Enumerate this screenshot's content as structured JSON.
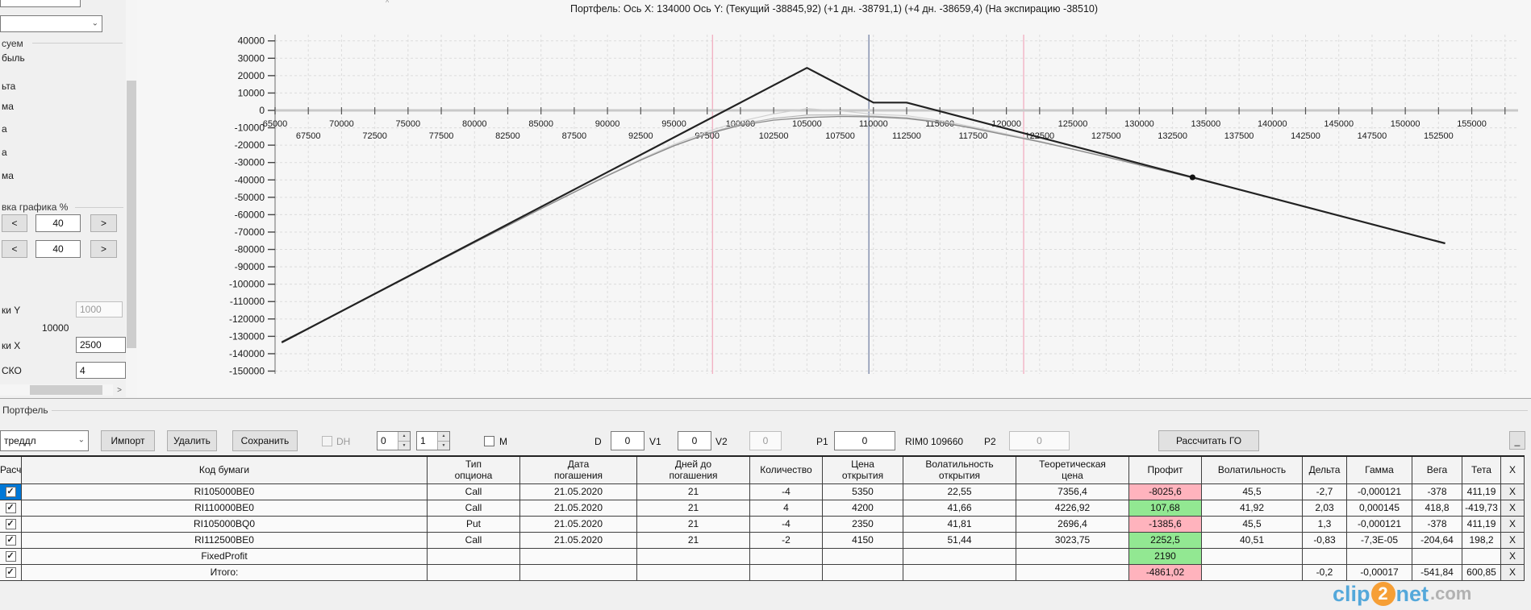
{
  "chart_data": {
    "type": "line",
    "title": "Портфель: Ось X: 134000 Ось Y:  (Текущий -38845,92)  (+1 дн. -38791,1)  (+4 дн. -38659,4)  (На экспирацию -38510)",
    "readouts": {
      "x": "134000",
      "current": "-38845,92",
      "plus1d": "-38791,1",
      "plus4d": "-38659,4",
      "expiration": "-38510"
    },
    "x_range": [
      65000,
      157500
    ],
    "y_range": [
      -150000,
      40000
    ],
    "grid": true,
    "x_minor_step": 2500,
    "y_ticks": [
      40000,
      30000,
      20000,
      10000,
      0,
      -10000,
      -20000,
      -30000,
      -40000,
      -50000,
      -60000,
      -70000,
      -80000,
      -90000,
      -100000,
      -110000,
      -120000,
      -130000,
      -140000,
      -150000
    ],
    "x_ticks_row1": [
      65000,
      70000,
      75000,
      80000,
      85000,
      90000,
      95000,
      100000,
      105000,
      110000,
      115000,
      120000,
      125000,
      130000,
      135000,
      140000,
      145000,
      150000,
      155000
    ],
    "x_ticks_row2": [
      67500,
      72500,
      77500,
      82500,
      87500,
      92500,
      97500,
      102500,
      107500,
      112500,
      117500,
      122500,
      127500,
      132500,
      137500,
      142500,
      147500,
      152500
    ],
    "vlines": [
      {
        "x": 109660,
        "color": "#7f8bab",
        "name": "current-price-line"
      },
      {
        "x": 97900,
        "color": "#f2b3c4",
        "name": "band-low-line"
      },
      {
        "x": 121300,
        "color": "#f2b3c4",
        "name": "band-high-line"
      }
    ],
    "series": [
      {
        "name": "expiration",
        "color": "#222222",
        "width": 2.2,
        "points": [
          [
            65500,
            -133510
          ],
          [
            105000,
            24490
          ],
          [
            110000,
            4490
          ],
          [
            112500,
            4490
          ],
          [
            153000,
            -76510
          ]
        ]
      },
      {
        "name": "current",
        "color": "#8a8a8a",
        "width": 1.3,
        "points": [
          [
            65500,
            -133000
          ],
          [
            70000,
            -115700
          ],
          [
            75000,
            -95900
          ],
          [
            80000,
            -76100
          ],
          [
            85000,
            -56600
          ],
          [
            90000,
            -37600
          ],
          [
            92500,
            -28600
          ],
          [
            95000,
            -20400
          ],
          [
            97500,
            -13600
          ],
          [
            100000,
            -8600
          ],
          [
            102500,
            -5600
          ],
          [
            105000,
            -4100
          ],
          [
            107500,
            -3500
          ],
          [
            110000,
            -3700
          ],
          [
            112500,
            -4700
          ],
          [
            115000,
            -6900
          ],
          [
            117500,
            -10300
          ],
          [
            120000,
            -14200
          ],
          [
            122500,
            -18100
          ],
          [
            125000,
            -22400
          ],
          [
            127500,
            -26800
          ],
          [
            130000,
            -31400
          ],
          [
            132500,
            -36000
          ],
          [
            134000,
            -38846
          ],
          [
            135000,
            -40800
          ],
          [
            137500,
            -45600
          ],
          [
            140000,
            -50600
          ],
          [
            142500,
            -55600
          ],
          [
            145000,
            -60570
          ],
          [
            147500,
            -65550
          ],
          [
            150000,
            -70540
          ],
          [
            152500,
            -75520
          ]
        ]
      },
      {
        "name": "plus1d",
        "blend_of": [
          "current",
          "expiration"
        ],
        "factor": 0.05,
        "color": "#b3b3b3",
        "width": 1.1
      },
      {
        "name": "plus4d",
        "blend_of": [
          "current",
          "expiration"
        ],
        "factor": 0.18,
        "color": "#cfcfcf",
        "width": 1.1
      }
    ],
    "marker": {
      "x": 134000,
      "y": -38510,
      "color": "#111111"
    }
  },
  "sidebar": {
    "top_combo_value": "",
    "draw_group_label": "суем",
    "draw_items": [
      "быль",
      "ьта",
      "ма",
      "а",
      "а",
      "ма"
    ],
    "scale_group_label": "вка графика %",
    "scale_rows": [
      {
        "dec": "<",
        "value": "40",
        "inc": ">"
      },
      {
        "dec": "<",
        "value": "40",
        "inc": ">"
      }
    ],
    "step_y_label": "ки Y",
    "step_y_value": "1000",
    "step_mid_value": "10000",
    "step_x_label": "ки X",
    "step_x_value": "2500",
    "sko_label": "СКО",
    "sko_value": "4",
    "hscroll_arrow": ">",
    "panel_caret": "^"
  },
  "portfolio": {
    "group_label": "Портфель",
    "strategy_combo_value": "треддл",
    "import_label": "Импорт",
    "delete_label": "Удалить",
    "save_label": "Сохранить",
    "dh_label": "DH",
    "spin1_value": "0",
    "spin2_value": "1",
    "m_label": "M",
    "d_label": "D",
    "d_value": "0",
    "v1_label": "V1",
    "v1_value": "0",
    "v2_label": "V2",
    "v2_value": "0",
    "p1_label": "P1",
    "p1_value": "0",
    "rim_label": "RIM0 109660",
    "p2_label": "P2",
    "p2_value": "0",
    "calc_go_label": "Рассчитать ГО",
    "minimize_label": "_"
  },
  "table": {
    "headers": [
      "Расчет",
      "Код бумаги",
      "Тип\nопциона",
      "Дата\nпогашения",
      "Дней до\nпогашения",
      "Количество",
      "Цена\nоткрытия",
      "Волатильность\nоткрытия",
      "Теоретическая\nцена",
      "Профит",
      "Волатильность",
      "Дельта",
      "Гамма",
      "Вега",
      "Тета",
      "X"
    ],
    "pink": "#ffb3bd",
    "green": "#92e892",
    "rows": [
      {
        "checked": true,
        "selected": true,
        "profit_color": "#ffb3bd",
        "cells": [
          "RI105000BE0",
          "Call",
          "21.05.2020",
          "21",
          "-4",
          "5350",
          "22,55",
          "7356,4",
          "-8025,6",
          "45,5",
          "-2,7",
          "-0,000121",
          "-378",
          "411,19",
          "X"
        ]
      },
      {
        "checked": true,
        "selected": false,
        "profit_color": "#92e892",
        "cells": [
          "RI110000BE0",
          "Call",
          "21.05.2020",
          "21",
          "4",
          "4200",
          "41,66",
          "4226,92",
          "107,68",
          "41,92",
          "2,03",
          "0,000145",
          "418,8",
          "-419,73",
          "X"
        ]
      },
      {
        "checked": true,
        "selected": false,
        "profit_color": "#ffb3bd",
        "cells": [
          "RI105000BQ0",
          "Put",
          "21.05.2020",
          "21",
          "-4",
          "2350",
          "41,81",
          "2696,4",
          "-1385,6",
          "45,5",
          "1,3",
          "-0,000121",
          "-378",
          "411,19",
          "X"
        ]
      },
      {
        "checked": true,
        "selected": false,
        "profit_color": "#92e892",
        "cells": [
          "RI112500BE0",
          "Call",
          "21.05.2020",
          "21",
          "-2",
          "4150",
          "51,44",
          "3023,75",
          "2252,5",
          "40,51",
          "-0,83",
          "-7,3E-05",
          "-204,64",
          "198,2",
          "X"
        ]
      },
      {
        "checked": true,
        "selected": false,
        "profit_color": "#92e892",
        "cells": [
          "FixedProfit",
          "",
          "",
          "",
          "",
          "",
          "",
          "",
          "2190",
          "",
          "",
          "",
          "",
          "",
          "X"
        ]
      },
      {
        "checked": true,
        "selected": false,
        "profit_color": "#ffb3bd",
        "cells": [
          "Итого:",
          "",
          "",
          "",
          "",
          "",
          "",
          "",
          "-4861,02",
          "",
          "-0,2",
          "-0,00017",
          "-541,84",
          "600,85",
          "X"
        ]
      }
    ]
  },
  "watermark": {
    "clip": "clip",
    "two": "2",
    "net": "net",
    "com": ".com"
  }
}
